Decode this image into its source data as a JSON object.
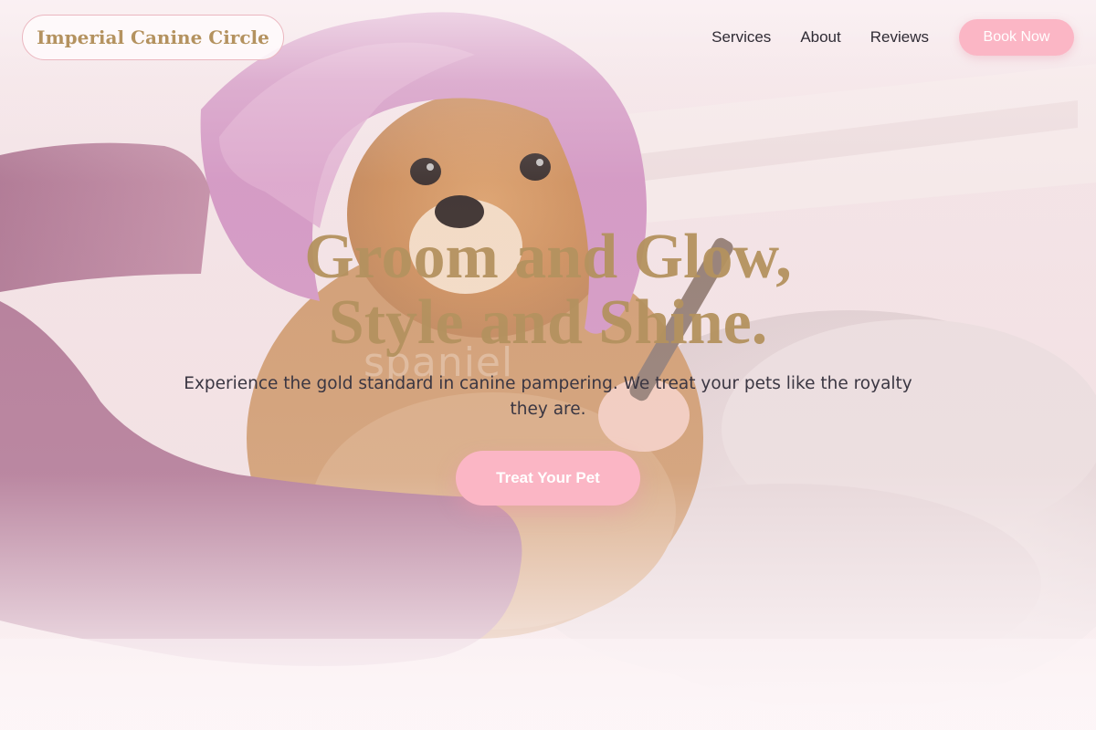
{
  "nav": {
    "brand": "Imperial Canine Circle",
    "links": [
      {
        "label": "Services"
      },
      {
        "label": "About"
      },
      {
        "label": "Reviews"
      }
    ],
    "book_label": "Book Now"
  },
  "hero": {
    "title_line1": "Groom and Glow,",
    "title_line2": "Style and Shine.",
    "subtitle": "Experience the gold standard in canine pampering. We treat your pets like the royalty they are.",
    "cta_label": "Treat Your Pet",
    "image_watermark": "spaniel"
  },
  "colors": {
    "gold": "#b4925f",
    "pink_button": "#fbb6c5",
    "pink_border": "#ebb7c0",
    "text_dark": "#2f2b34",
    "page_bg": "#fcf2f4"
  }
}
